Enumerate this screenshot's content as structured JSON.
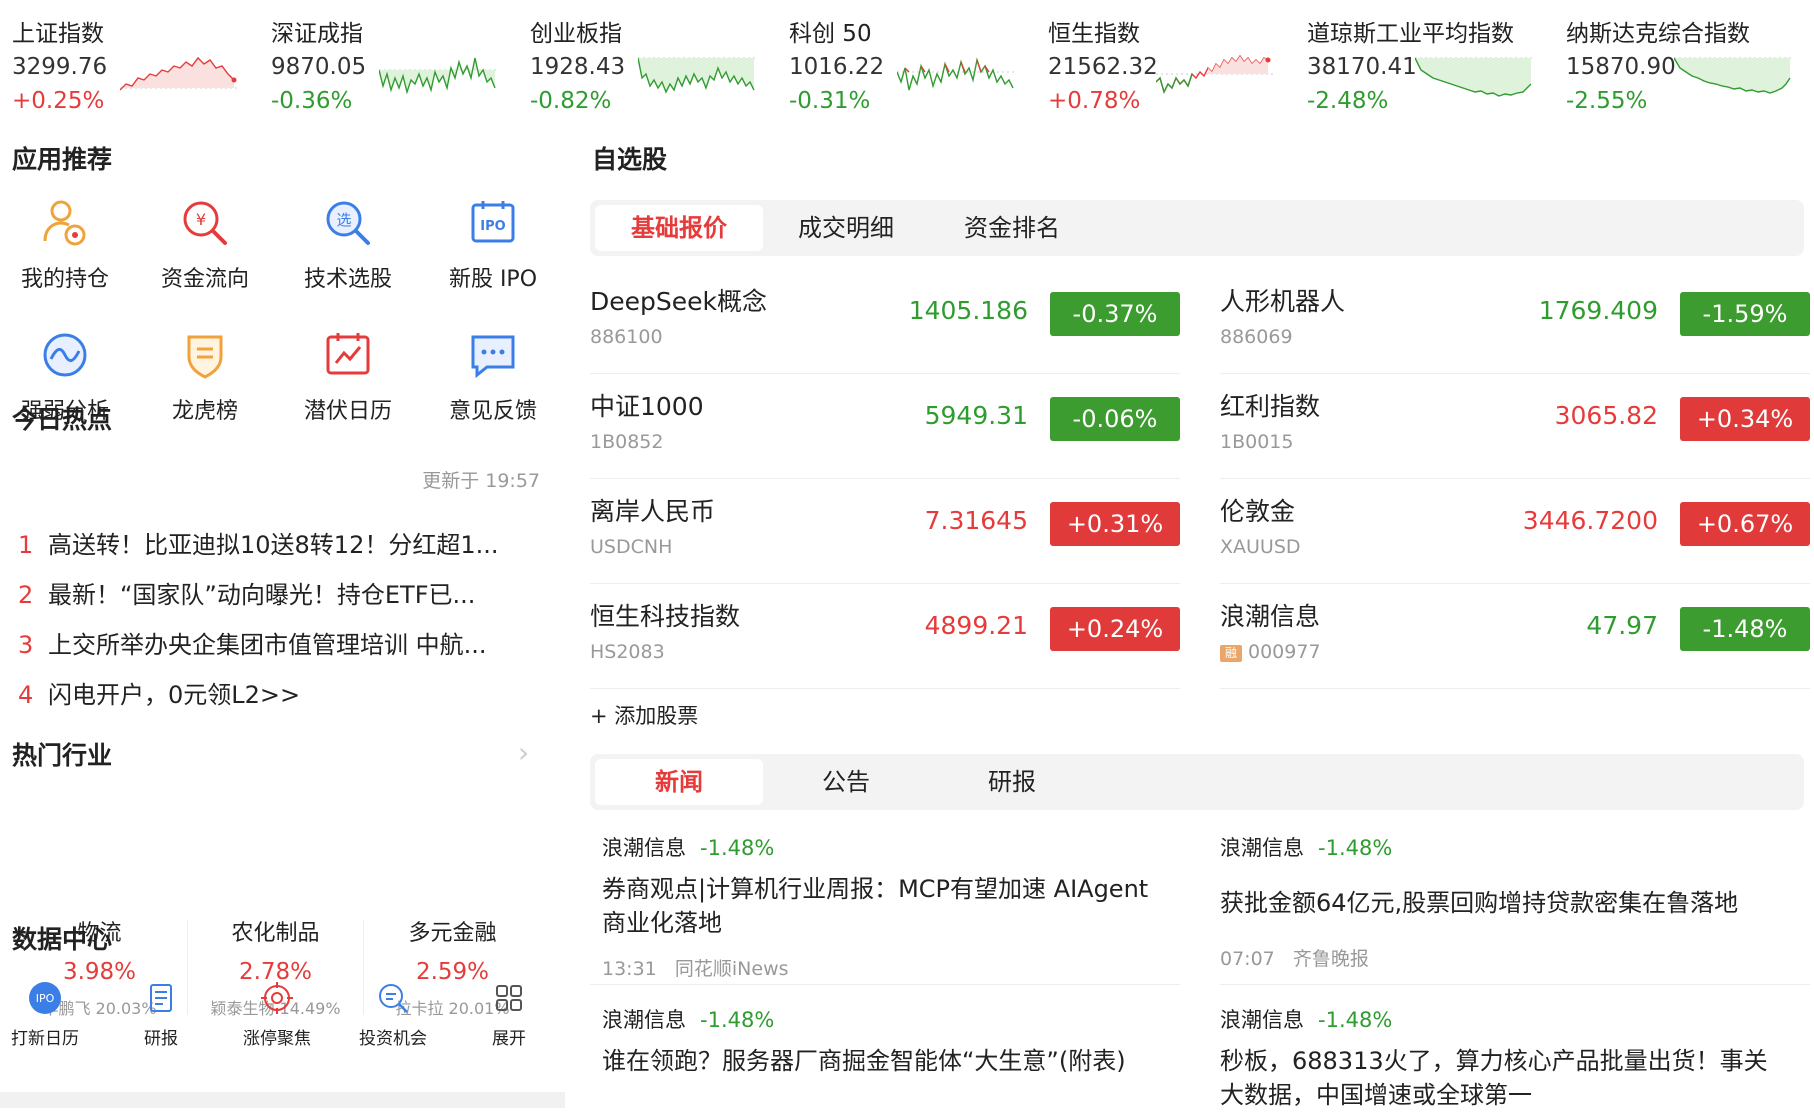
{
  "indices": [
    {
      "name": "上证指数",
      "value": "3299.76",
      "change": "+0.25%",
      "trend": "up"
    },
    {
      "name": "深证成指",
      "value": "9870.05",
      "change": "-0.36%",
      "trend": "down"
    },
    {
      "name": "创业板指",
      "value": "1928.43",
      "change": "-0.82%",
      "trend": "down"
    },
    {
      "name": "科创 50",
      "value": "1016.22",
      "change": "-0.31%",
      "trend": "down"
    },
    {
      "name": "恒生指数",
      "value": "21562.32",
      "change": "+0.78%",
      "trend": "up"
    },
    {
      "name": "道琼斯工业平均指数",
      "value": "38170.41",
      "change": "-2.48%",
      "trend": "down"
    },
    {
      "name": "纳斯达克综合指数",
      "value": "15870.90",
      "change": "-2.55%",
      "trend": "down"
    }
  ],
  "apps": {
    "title": "应用推荐",
    "items": [
      {
        "label": "我的持仓",
        "icon": "portfolio-icon"
      },
      {
        "label": "资金流向",
        "icon": "money-flow-icon"
      },
      {
        "label": "技术选股",
        "icon": "stock-picker-icon"
      },
      {
        "label": "新股 IPO",
        "icon": "ipo-icon"
      },
      {
        "label": "强弱分析",
        "icon": "strength-analysis-icon"
      },
      {
        "label": "龙虎榜",
        "icon": "dragon-tiger-icon"
      },
      {
        "label": "潜伏日历",
        "icon": "calendar-icon"
      },
      {
        "label": "意见反馈",
        "icon": "feedback-icon"
      }
    ]
  },
  "hot_today": {
    "title": "今日热点",
    "updated": "更新于 19:57",
    "items": [
      {
        "rank": "1",
        "text": "高送转！比亚迪拟10送8转12！分红超1..."
      },
      {
        "rank": "2",
        "text": "最新！“国家队”动向曝光！持仓ETF已..."
      },
      {
        "rank": "3",
        "text": "上交所举办央企集团市值管理培训 中航..."
      },
      {
        "rank": "4",
        "text": "闪电开户，0元领L2>>"
      }
    ]
  },
  "hot_industry": {
    "title": "热门行业",
    "items": [
      {
        "name": "物流",
        "change": "3.98%",
        "leader": "华鹏飞 20.03%"
      },
      {
        "name": "农化制品",
        "change": "2.78%",
        "leader": "颖泰生物 14.49%"
      },
      {
        "name": "多元金融",
        "change": "2.59%",
        "leader": "拉卡拉 20.01%"
      }
    ]
  },
  "data_center": {
    "title": "数据中心",
    "items": [
      {
        "label": "打新日历",
        "icon": "ipo-badge-icon"
      },
      {
        "label": "研报",
        "icon": "report-icon"
      },
      {
        "label": "涨停聚焦",
        "icon": "target-icon"
      },
      {
        "label": "投资机会",
        "icon": "search-opportunity-icon"
      },
      {
        "label": "展开",
        "icon": "grid-expand-icon"
      }
    ]
  },
  "watchlist": {
    "title": "自选股",
    "tabs": [
      "基础报价",
      "成交明细",
      "资金排名"
    ],
    "active_tab": 0,
    "stocks": [
      {
        "name": "DeepSeek概念",
        "code": "886100",
        "price": "1405.186",
        "change": "-0.37%",
        "trend": "down",
        "tag": ""
      },
      {
        "name": "人形机器人",
        "code": "886069",
        "price": "1769.409",
        "change": "-1.59%",
        "trend": "down",
        "tag": ""
      },
      {
        "name": "中证1000",
        "code": "1B0852",
        "price": "5949.31",
        "change": "-0.06%",
        "trend": "down",
        "tag": ""
      },
      {
        "name": "红利指数",
        "code": "1B0015",
        "price": "3065.82",
        "change": "+0.34%",
        "trend": "up",
        "tag": ""
      },
      {
        "name": "离岸人民币",
        "code": "USDCNH",
        "price": "7.31645",
        "change": "+0.31%",
        "trend": "up",
        "tag": ""
      },
      {
        "name": "伦敦金",
        "code": "XAUUSD",
        "price": "3446.7200",
        "change": "+0.67%",
        "trend": "up",
        "tag": ""
      },
      {
        "name": "恒生科技指数",
        "code": "HS2083",
        "price": "4899.21",
        "change": "+0.24%",
        "trend": "up",
        "tag": ""
      },
      {
        "name": "浪潮信息",
        "code": "000977",
        "price": "47.97",
        "change": "-1.48%",
        "trend": "down",
        "tag": "融"
      }
    ],
    "add_label": "+ 添加股票"
  },
  "news": {
    "tabs": [
      "新闻",
      "公告",
      "研报"
    ],
    "active_tab": 0,
    "items": [
      {
        "stock": "浪潮信息",
        "change": "-1.48%",
        "title": "券商观点|计算机行业周报：MCP有望加速 AIAgent商业化落地",
        "time": "13:31",
        "source": "同花顺iNews"
      },
      {
        "stock": "浪潮信息",
        "change": "-1.48%",
        "title": "获批金额64亿元,股票回购增持贷款密集在鲁落地",
        "time": "07:07",
        "source": "齐鲁晚报"
      },
      {
        "stock": "浪潮信息",
        "change": "-1.48%",
        "title": "谁在领跑？服务器厂商掘金智能体“大生意”(附表)",
        "time": "",
        "source": ""
      },
      {
        "stock": "浪潮信息",
        "change": "-1.48%",
        "title": "秒板，688313火了，算力核心产品批量出货！事关大数据，中国增速或全球第一",
        "time": "",
        "source": ""
      }
    ]
  },
  "colors": {
    "up": "#e63b3b",
    "down": "#2f9c2f",
    "up_badge": "#e03a3a",
    "down_badge": "#3d9c30"
  }
}
